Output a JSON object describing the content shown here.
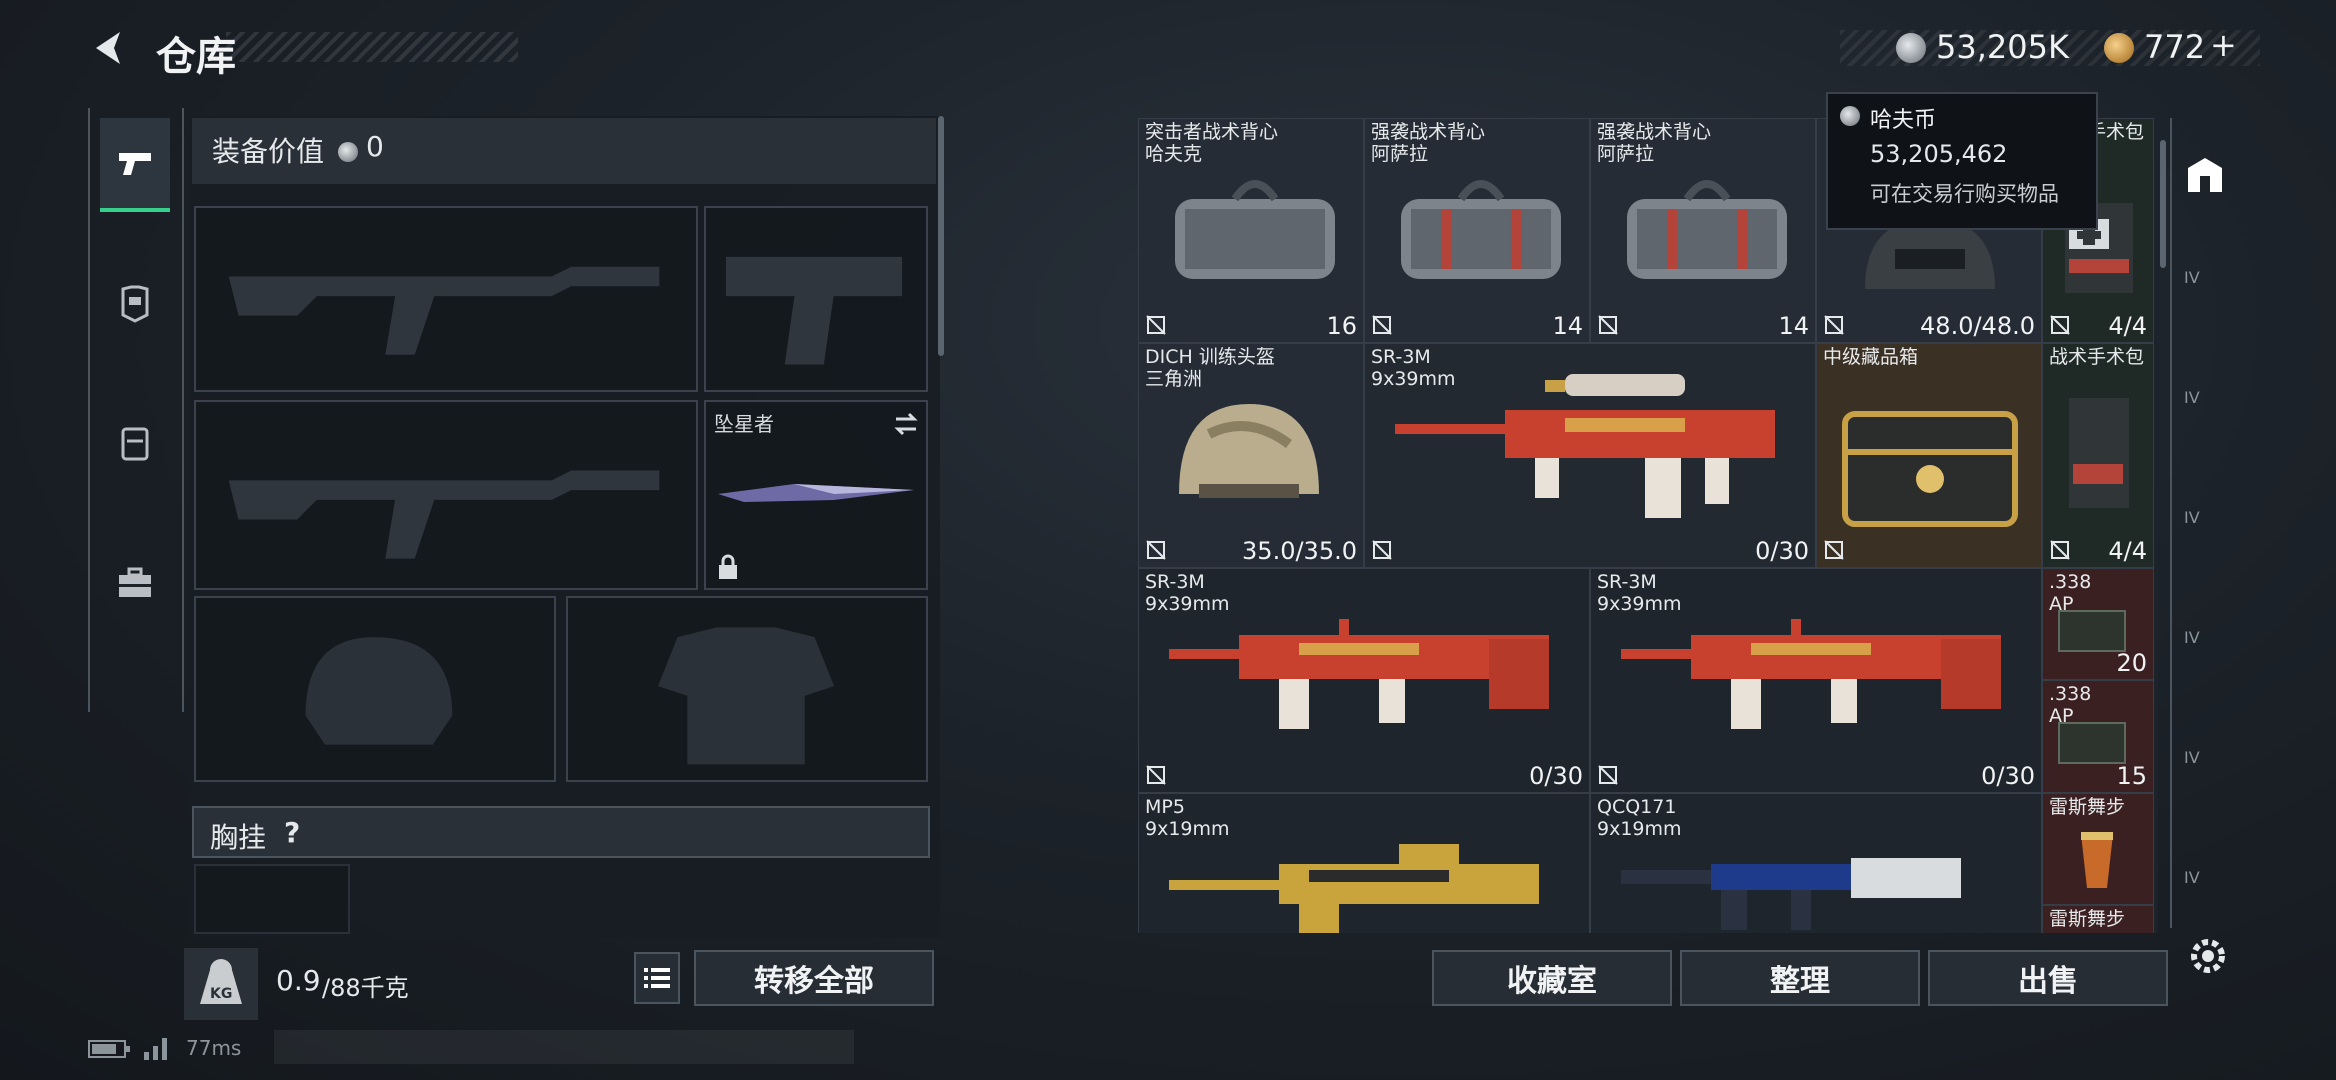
{
  "header": {
    "title": "仓库",
    "silver_amount": "53,205K",
    "gold_amount": "772",
    "gold_plus": "+"
  },
  "tooltip": {
    "title": "哈夫币",
    "value": "53,205,462",
    "note": "可在交易行购买物品"
  },
  "equipment": {
    "value_label": "装备价值",
    "value": "0",
    "melee_name": "坠星者",
    "chest_label": "胸挂",
    "chest_help": "?"
  },
  "bottom_left": {
    "weight_current": "0.9",
    "weight_max": "/88千克",
    "weight_icon_text": "KG",
    "transfer_all": "转移全部",
    "ping": "77ms"
  },
  "grid_items": [
    {
      "name": "突击者战术背心",
      "sub": "哈夫克",
      "count": "16"
    },
    {
      "name": "强袭战术背心",
      "sub": "阿萨拉",
      "count": "14"
    },
    {
      "name": "强袭战术背心",
      "sub": "阿萨拉",
      "count": "14"
    },
    {
      "name": "",
      "sub": "",
      "count": "48.0/48.0"
    },
    {
      "name": "战术手术包",
      "sub": "",
      "count": "4/4"
    },
    {
      "name": "DICH 训练头盔",
      "sub": "三角洲",
      "count": "35.0/35.0"
    },
    {
      "name": "SR-3M",
      "sub": "9x39mm",
      "count": "0/30"
    },
    {
      "name": "中级藏品箱",
      "sub": "",
      "count": ""
    },
    {
      "name": "战术手术包",
      "sub": "",
      "count": "4/4"
    },
    {
      "name": "SR-3M",
      "sub": "9x39mm",
      "count": "0/30"
    },
    {
      "name": "SR-3M",
      "sub": "9x39mm",
      "count": "0/30"
    },
    {
      "name": ".338",
      "sub": "AP",
      "count": "20"
    },
    {
      "name": ".338",
      "sub": "AP",
      "count": "15"
    },
    {
      "name": "MP5",
      "sub": "9x19mm",
      "count": ""
    },
    {
      "name": "QCQ171",
      "sub": "9x19mm",
      "count": ""
    },
    {
      "name": "雷斯舞步",
      "sub": "",
      "count": ""
    },
    {
      "name": "雷斯舞步",
      "sub": "",
      "count": ""
    }
  ],
  "bottom_right": {
    "collection": "收藏室",
    "organize": "整理",
    "sell": "出售"
  },
  "right_strip": {
    "level_labels": [
      "IV",
      "IV",
      "IV",
      "IV",
      "IV",
      "IV"
    ]
  },
  "icons": {
    "back": "back-arrow-icon",
    "weapon_tab": "pistol-icon",
    "armor_tab": "armor-icon",
    "backpack_tab": "backpack-icon",
    "case_tab": "briefcase-icon",
    "list": "list-icon",
    "settings": "gear-icon",
    "home": "home-icon",
    "lock": "lock-icon",
    "swap": "swap-icon"
  },
  "colors": {
    "accent_green": "#35d08c",
    "red_rarity": "#3b2022",
    "gold_rarity": "#3a3024",
    "weapon_red": "#c8412e"
  }
}
